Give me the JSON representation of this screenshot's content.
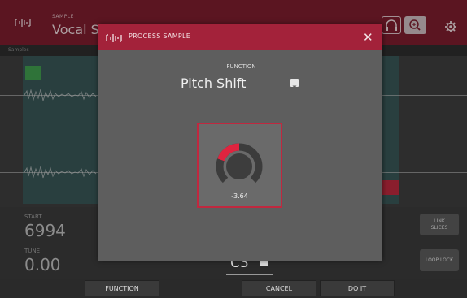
{
  "topbar": {
    "sample_label": "SAMPLE",
    "sample_name": "Vocal Sar"
  },
  "ruler": {
    "label": "Samples"
  },
  "params": {
    "start_label": "START",
    "start_value": "6994",
    "tune_label": "TUNE",
    "tune_value": "0.00",
    "note_value": "C3"
  },
  "side_buttons": {
    "link_slices_line1": "LINK",
    "link_slices_line2": "SLICES",
    "loop_lock": "LOOP LOCK"
  },
  "bottombar": {
    "function": "FUNCTION",
    "cancel": "CANCEL",
    "do_it": "DO IT"
  },
  "dialog": {
    "title": "PROCESS SAMPLE",
    "function_label": "FUNCTION",
    "function_value": "Pitch Shift",
    "knob_value": "-3.64",
    "knob_level_fraction": 0.1
  },
  "colors": {
    "accent": "#a3223a",
    "knob_arc": "#e0243f",
    "slice_region": "#355e5e",
    "slice_start": "#3f9a4d",
    "slice_end": "#b8283c"
  },
  "icons": {
    "app": "waveform-icon",
    "headphones": "headphones-icon",
    "zoom": "zoom-icon",
    "settings": "gear-icon",
    "close": "close-icon"
  }
}
